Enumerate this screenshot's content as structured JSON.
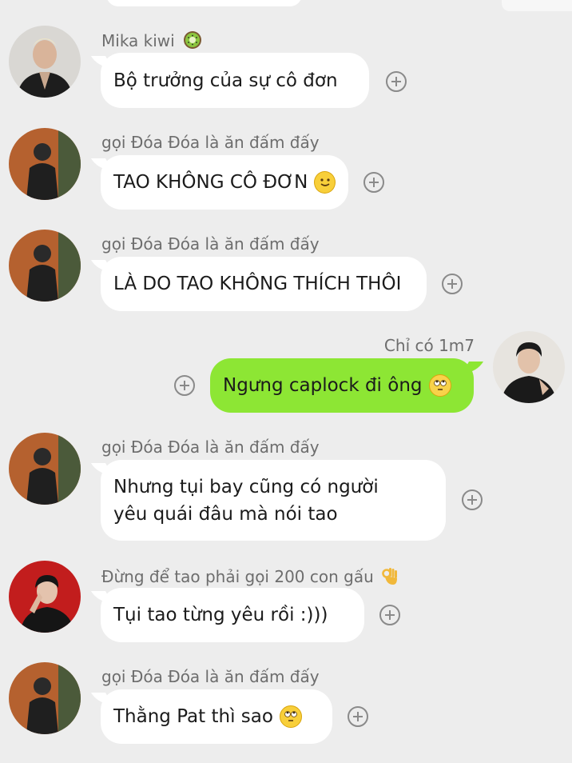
{
  "colors": {
    "background": "#ededed",
    "incoming_bubble": "#ffffff",
    "outgoing_bubble": "#8de634",
    "sender_text": "#6d6d6d",
    "message_text": "#1b1b1b"
  },
  "messages": [
    {
      "sender": "Mika kiwi",
      "sender_emoji": "kiwi-icon",
      "text": "Bộ trưởng của sự cô đơn",
      "emoji": ""
    },
    {
      "sender": "gọi Đóa Đóa là ăn đấm đấy",
      "text": "TAO KHÔNG CÔ ĐƠN",
      "emoji": "slightly-smiling-face-icon"
    },
    {
      "sender": "gọi Đóa Đóa là ăn đấm đấy",
      "text": "LÀ DO TAO KHÔNG THÍCH THÔI",
      "emoji": ""
    },
    {
      "sender": "Chỉ có 1m7",
      "text": "Ngưng caplock đi ông",
      "emoji": "eye-roll-face-icon",
      "outgoing": true
    },
    {
      "sender": "gọi Đóa Đóa là ăn đấm đấy",
      "text_line1": "Nhưng tụi bay cũng có người",
      "text_line2": "yêu quái đâu mà nói tao",
      "emoji": ""
    },
    {
      "sender": "Đừng để tao phải gọi 200 con gấu",
      "sender_emoji": "ok-hand-icon",
      "text": "Tụi tao từng yêu rồi :)))",
      "emoji": ""
    },
    {
      "sender": "gọi Đóa Đóa là ăn đấm đấy",
      "text": "Thằng Pat thì sao",
      "emoji": "eye-roll-face-icon"
    }
  ]
}
